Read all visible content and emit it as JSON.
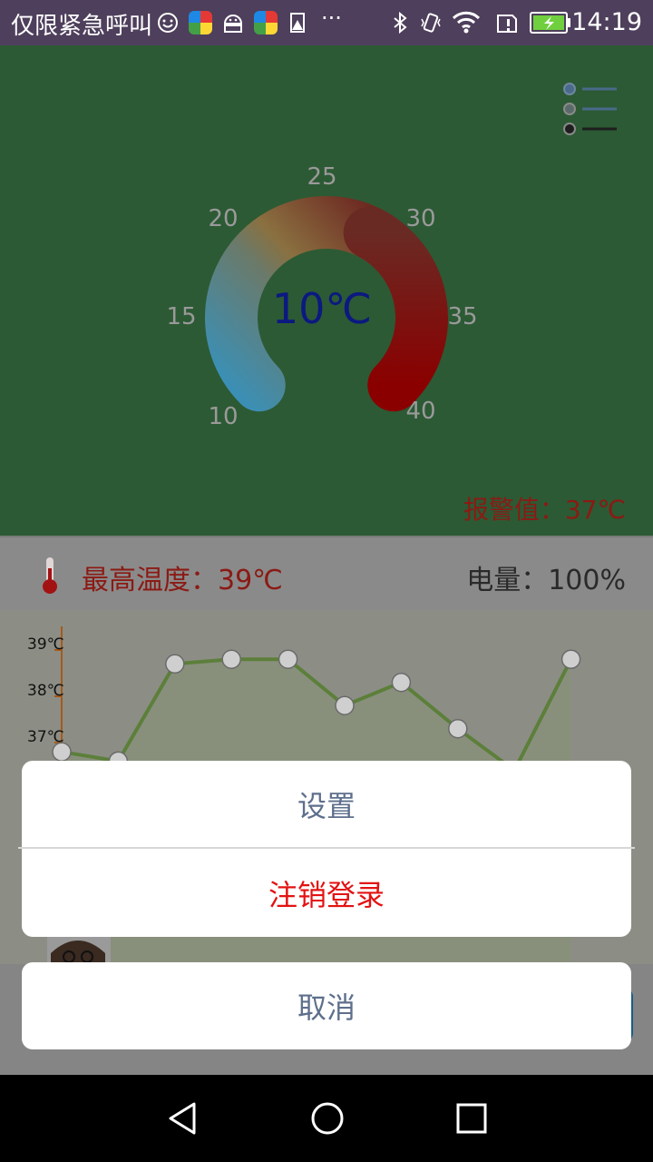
{
  "status_bar": {
    "carrier": "仅限紧急呼叫",
    "time": "14:19",
    "dots": "···",
    "icons": [
      "baby-face-icon",
      "app-badge-icon",
      "android-icon",
      "app-badge-icon",
      "warning-doc-icon",
      "bluetooth-icon",
      "vibrate-icon",
      "wifi-icon",
      "sim-alert-icon",
      "battery-charging-icon"
    ]
  },
  "gauge": {
    "ticks": [
      "10",
      "15",
      "20",
      "25",
      "30",
      "35",
      "40"
    ],
    "current": "10℃",
    "min": 10,
    "max": 40,
    "value": 10,
    "menu_icon": "list-menu-icon",
    "alarm": "报警值：37℃",
    "colors": {
      "cold": "#3c8fb4",
      "warm": "#8a7040",
      "hot": "#8a0000",
      "value": "#0b1980"
    }
  },
  "info": {
    "thermometer_icon": "thermometer-icon",
    "max_temp": "最高温度：39℃",
    "battery": "电量：100%"
  },
  "chart_data": {
    "type": "line",
    "y_ticks": [
      "39℃",
      "38℃",
      "37℃"
    ],
    "series": [
      {
        "points": [
          [
            0,
            36.8
          ],
          [
            1,
            36.6
          ],
          [
            2,
            38.7
          ],
          [
            3,
            38.8
          ],
          [
            4,
            38.8
          ],
          [
            5,
            37.8
          ],
          [
            6,
            38.3
          ],
          [
            7,
            37.3
          ],
          [
            8,
            36.4
          ],
          [
            9,
            38.8
          ]
        ]
      }
    ],
    "colors": {
      "line": "#5c7f3a",
      "marker": "#cfcfcf"
    }
  },
  "action_sheet": {
    "settings": "设置",
    "logout": "注销登录",
    "cancel": "取消"
  },
  "nav_bar": {
    "icons": [
      "back-icon",
      "home-icon",
      "recents-icon"
    ]
  }
}
